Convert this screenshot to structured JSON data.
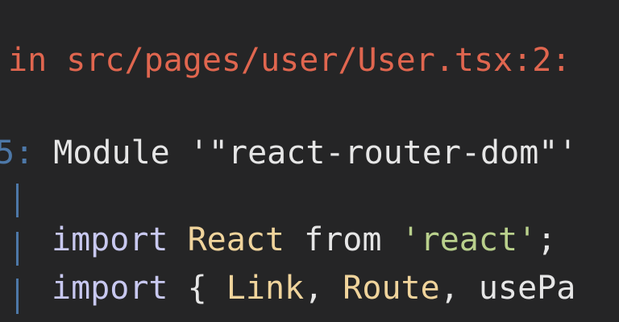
{
  "error": {
    "prefix": "in ",
    "path": "src/pages/user/User.tsx:2:"
  },
  "message": {
    "gutter": "5:",
    "text": " Module '\"react-router-dom\"'"
  },
  "code": {
    "line1": {
      "kw_import": "import",
      "ident": "React",
      "kw_from": "from",
      "str": "'react'",
      "semi": ";"
    },
    "line2": {
      "kw_import": "import",
      "brace": "{",
      "ident1": "Link",
      "comma1": ",",
      "ident2": "Route",
      "comma2": ",",
      "ident3": "usePa"
    }
  },
  "colors": {
    "background": "#252526",
    "error": "#e0664f",
    "gutter": "#4d78a8",
    "keyword": "#c8c8f0",
    "identifier": "#f0d49c",
    "string": "#b9d08c"
  }
}
